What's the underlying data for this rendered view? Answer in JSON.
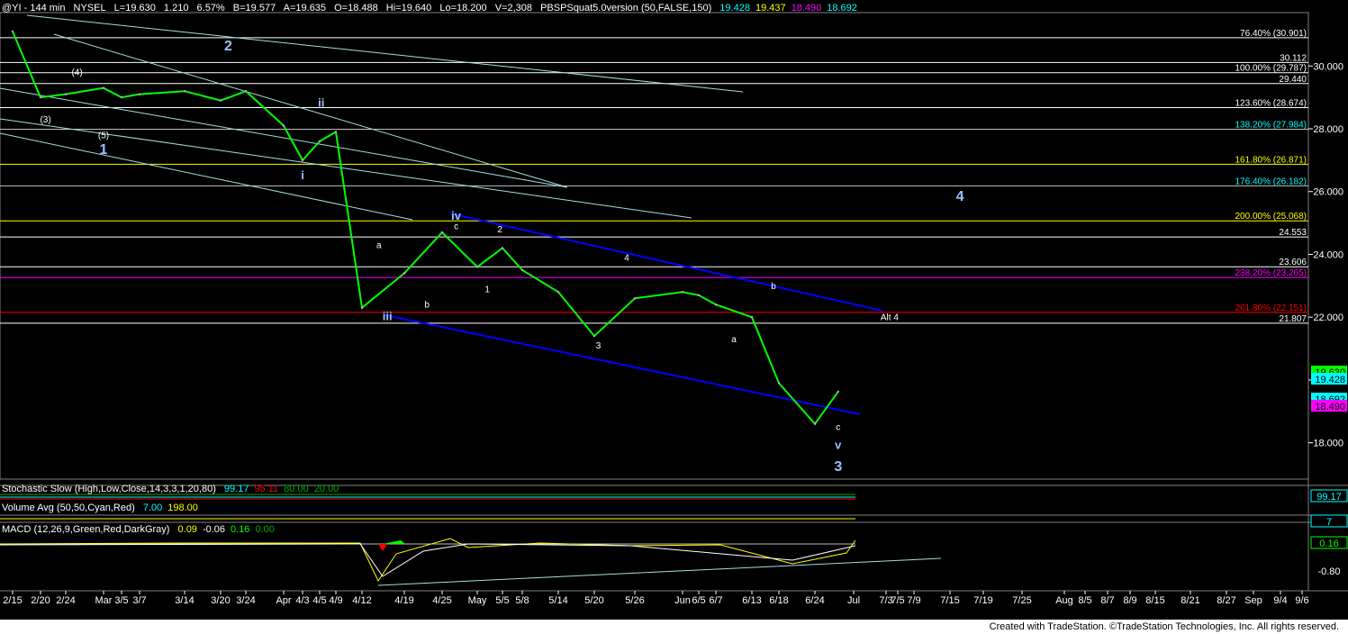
{
  "header": {
    "symbol": "@YI - 144 min",
    "exchange": "NYSEL",
    "last": "L=19.630",
    "change": "1.210",
    "change_pct": "6.57%",
    "bid": "B=19.577",
    "ask": "A=19.635",
    "open": "O=18.488",
    "high": "Hi=19.640",
    "low": "Lo=18.200",
    "volume": "V=2,308",
    "study": "PBSPSquat5.0version (50,FALSE,150)",
    "study_values": [
      {
        "text": "19.428",
        "color": "#00ffff"
      },
      {
        "text": "19.437",
        "color": "#ffff00"
      },
      {
        "text": "18.490",
        "color": "#ff00ff"
      },
      {
        "text": "18.692",
        "color": "#00ffff"
      }
    ]
  },
  "chart_data": {
    "type": "line",
    "title": "@YI - 144 min",
    "x": [
      "2/15",
      "2/20",
      "2/24",
      "Mar",
      "3/5",
      "3/7",
      "3/14",
      "3/20",
      "3/24",
      "Apr",
      "4/3",
      "4/5",
      "4/9",
      "4/12",
      "4/19",
      "4/25",
      "May",
      "5/5",
      "5/8",
      "5/14",
      "5/20",
      "5/26",
      "Jun",
      "6/5",
      "6/7",
      "6/13",
      "6/18",
      "6/24",
      "Jul",
      "7/3",
      "7/5",
      "7/9",
      "7/15",
      "7/19",
      "7/25",
      "Aug",
      "8/5",
      "8/7",
      "8/9",
      "8/15",
      "8/21",
      "8/27",
      "Sep",
      "9/4",
      "9/6"
    ],
    "price": [
      31.1,
      29.0,
      29.1,
      29.3,
      29.0,
      29.1,
      29.2,
      28.9,
      29.2,
      28.1,
      27.0,
      27.6,
      27.9,
      22.3,
      23.4,
      24.7,
      23.6,
      24.2,
      23.5,
      22.8,
      21.4,
      22.6,
      22.8,
      22.7,
      22.4,
      22.0,
      19.9,
      18.6,
      19.63
    ],
    "price_x_index": [
      0,
      1,
      2,
      3,
      4,
      5,
      6,
      7,
      8,
      9,
      10,
      11,
      12,
      13,
      14,
      15,
      16,
      17,
      18,
      19,
      20,
      21,
      22,
      23,
      24,
      25,
      26,
      27,
      27.6
    ],
    "y_ticks": [
      "30.000",
      "28.000",
      "26.000",
      "24.000",
      "22.000",
      "20.000",
      "18.000"
    ],
    "ylim": [
      16.9,
      31.7
    ],
    "last_value_labels": [
      {
        "text": "19.630",
        "bg": "#00ff00",
        "fg": "#000000"
      },
      {
        "text": "19.428",
        "bg": "#00ffff",
        "fg": "#000000"
      },
      {
        "text": "18.692",
        "bg": "#00ffff",
        "fg": "#000000"
      },
      {
        "text": "18.490",
        "bg": "#ff00ff",
        "fg": "#000000"
      }
    ],
    "levels": [
      {
        "value": 30.901,
        "label": "76.40% (30.901)",
        "color": "#ffffff",
        "label_color": "#ffffff"
      },
      {
        "value": 30.112,
        "label": "30.112",
        "color": "#ffffff",
        "label_color": "#ffffff"
      },
      {
        "value": 29.787,
        "label": "100.00% (29.787)",
        "color": "#ffffff",
        "label_color": "#ffffff"
      },
      {
        "value": 29.44,
        "label": "29.440",
        "color": "#ffffff",
        "label_color": "#ffffff"
      },
      {
        "value": 28.674,
        "label": "123.60% (28.674)",
        "color": "#ffffff",
        "label_color": "#ffffff"
      },
      {
        "value": 27.984,
        "label": "138.20% (27.984)",
        "color": "#c0c0c0",
        "label_color": "#00ffff"
      },
      {
        "value": 26.871,
        "label": "161.80% (26.871)",
        "color": "#ffff00",
        "label_color": "#ffff00"
      },
      {
        "value": 26.182,
        "label": "176.40% (26.182)",
        "color": "#c0c0c0",
        "label_color": "#00ffff"
      },
      {
        "value": 25.068,
        "label": "200.00% (25.068)",
        "color": "#ffff00",
        "label_color": "#ffff00"
      },
      {
        "value": 24.553,
        "label": "24.553",
        "color": "#ffffff",
        "label_color": "#ffffff"
      },
      {
        "value": 23.606,
        "label": "23.606",
        "color": "#ffffff",
        "label_color": "#ffffff"
      },
      {
        "value": 23.265,
        "label": "238.20% (23.265)",
        "color": "#ff00ff",
        "label_color": "#ff00ff"
      },
      {
        "value": 22.151,
        "label": "261.80% (22.151)",
        "color": "#ff0000",
        "label_color": "#ff0000"
      },
      {
        "value": 21.807,
        "label": "21.807",
        "color": "#ffffff",
        "label_color": "#ffffff"
      }
    ],
    "wave_labels": [
      {
        "text": "2",
        "x_index": 7.3,
        "y": 30.5,
        "size": "big"
      },
      {
        "text": "1",
        "x_index": 3.0,
        "y": 27.2,
        "size": "big"
      },
      {
        "text": "(3)",
        "x_index": 1.2,
        "y": 28.2,
        "size": "small"
      },
      {
        "text": "(5)",
        "x_index": 3.0,
        "y": 27.7,
        "size": "small"
      },
      {
        "text": "(4)",
        "x_index": 2.3,
        "y": 29.7,
        "size": "small"
      },
      {
        "text": "ii",
        "x_index": 11.1,
        "y": 28.7,
        "size": "mid"
      },
      {
        "text": "i",
        "x_index": 10.0,
        "y": 26.4,
        "size": "mid"
      },
      {
        "text": "iv",
        "x_index": 15.4,
        "y": 25.1,
        "size": "mid"
      },
      {
        "text": "c",
        "x_index": 15.4,
        "y": 24.8,
        "size": "small"
      },
      {
        "text": "a",
        "x_index": 13.4,
        "y": 24.2,
        "size": "small"
      },
      {
        "text": "b",
        "x_index": 14.6,
        "y": 22.3,
        "size": "small"
      },
      {
        "text": "iii",
        "x_index": 13.6,
        "y": 21.9,
        "size": "mid"
      },
      {
        "text": "1",
        "x_index": 16.4,
        "y": 22.8,
        "size": "small"
      },
      {
        "text": "2",
        "x_index": 16.9,
        "y": 24.7,
        "size": "small"
      },
      {
        "text": "4",
        "x_index": 20.8,
        "y": 23.8,
        "size": "small"
      },
      {
        "text": "3",
        "x_index": 20.1,
        "y": 21.0,
        "size": "small"
      },
      {
        "text": "a",
        "x_index": 24.5,
        "y": 21.2,
        "size": "small"
      },
      {
        "text": "b",
        "x_index": 25.8,
        "y": 22.9,
        "size": "small"
      },
      {
        "text": "c",
        "x_index": 27.6,
        "y": 18.4,
        "size": "small"
      },
      {
        "text": "v",
        "x_index": 27.6,
        "y": 17.8,
        "size": "mid"
      },
      {
        "text": "3",
        "x_index": 27.6,
        "y": 17.1,
        "size": "big"
      },
      {
        "text": "4",
        "x_index": 32.3,
        "y": 25.7,
        "size": "big"
      },
      {
        "text": "Alt 4",
        "x_index": 29.3,
        "y": 21.9,
        "size": "small"
      }
    ]
  },
  "indicators": {
    "stochastic": {
      "name": "Stochastic Slow (High,Low,Close,14,3,3,1,20,80)",
      "values": [
        {
          "text": "99.17",
          "color": "#00ffff"
        },
        {
          "text": "95.11",
          "color": "#ff0000"
        },
        {
          "text": "80.00",
          "color": "#00aa00"
        },
        {
          "text": "20.00",
          "color": "#00aa00"
        }
      ],
      "axis_label": "99.17"
    },
    "volume": {
      "name": "Volume Avg (50,50,Cyan,Red)",
      "values": [
        {
          "text": "7.00",
          "color": "#00ffff"
        },
        {
          "text": "198.00",
          "color": "#ffff00"
        }
      ],
      "axis_label": "7"
    },
    "macd": {
      "name": "MACD (12,26,9,Green,Red,DarkGray)",
      "values": [
        {
          "text": "0.09",
          "color": "#ffff00"
        },
        {
          "text": "-0.06",
          "color": "#ffffff"
        },
        {
          "text": "0.16",
          "color": "#00ff00"
        },
        {
          "text": "0.00",
          "color": "#00aa00"
        }
      ],
      "axis_label": "0.16",
      "axis_label2": "-0.80"
    }
  },
  "footer": "Created with TradeStation. ©TradeStation Technologies, Inc. All rights reserved."
}
